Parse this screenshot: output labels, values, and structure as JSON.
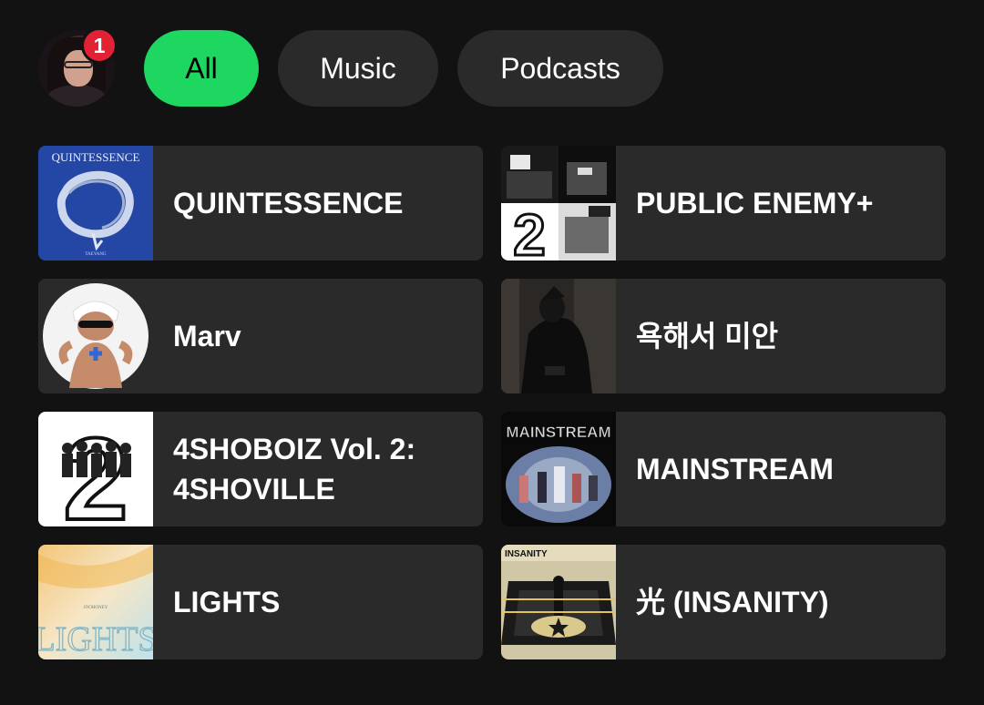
{
  "profile": {
    "notification_count": "1"
  },
  "filters": [
    {
      "label": "All",
      "active": true
    },
    {
      "label": "Music",
      "active": false
    },
    {
      "label": "Podcasts",
      "active": false
    }
  ],
  "shortcuts": [
    {
      "title": "QUINTESSENCE",
      "cover_text": "QUINTESSENCE",
      "cover_subtext": "TAEYANG"
    },
    {
      "title": "PUBLIC ENEMY+",
      "cover_text": "2"
    },
    {
      "title": "Marv"
    },
    {
      "title": "욕해서 미안"
    },
    {
      "title": "4SHOBOIZ Vol. 2: 4SHOVILLE",
      "cover_text": "2"
    },
    {
      "title": "MAINSTREAM",
      "cover_text": "MAINSTREAM"
    },
    {
      "title": "LIGHTS",
      "cover_text": "LIGHTS",
      "cover_subtext": "JOOHONEY"
    },
    {
      "title": "光 (INSANITY)",
      "cover_text": "INSANITY"
    }
  ],
  "colors": {
    "background": "#121212",
    "card": "#2a2a2a",
    "accent": "#1ed760",
    "badge": "#e22134"
  }
}
